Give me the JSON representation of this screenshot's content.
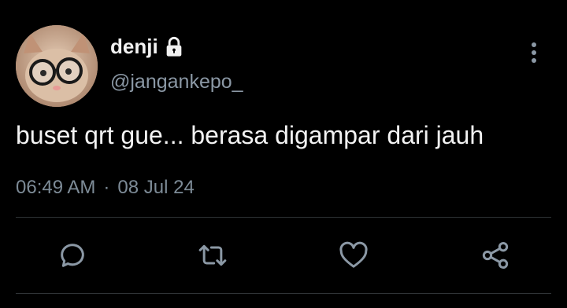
{
  "tweet": {
    "display_name": "denji",
    "handle": "@jangankepo_",
    "text": "buset qrt gue... berasa digampar dari jauh",
    "time": "06:49 AM",
    "separator": "·",
    "date": "08 Jul 24",
    "protected_icon": "lock-icon"
  },
  "actions": [
    {
      "name": "reply",
      "icon": "speech-bubble-icon"
    },
    {
      "name": "retweet",
      "icon": "retweet-arrows-icon"
    },
    {
      "name": "like",
      "icon": "heart-icon"
    },
    {
      "name": "share",
      "icon": "share-nodes-icon"
    }
  ],
  "colors": {
    "background": "#000000",
    "text": "#f3f3f3",
    "muted": "#8b98a5",
    "divider": "#2f3336"
  }
}
